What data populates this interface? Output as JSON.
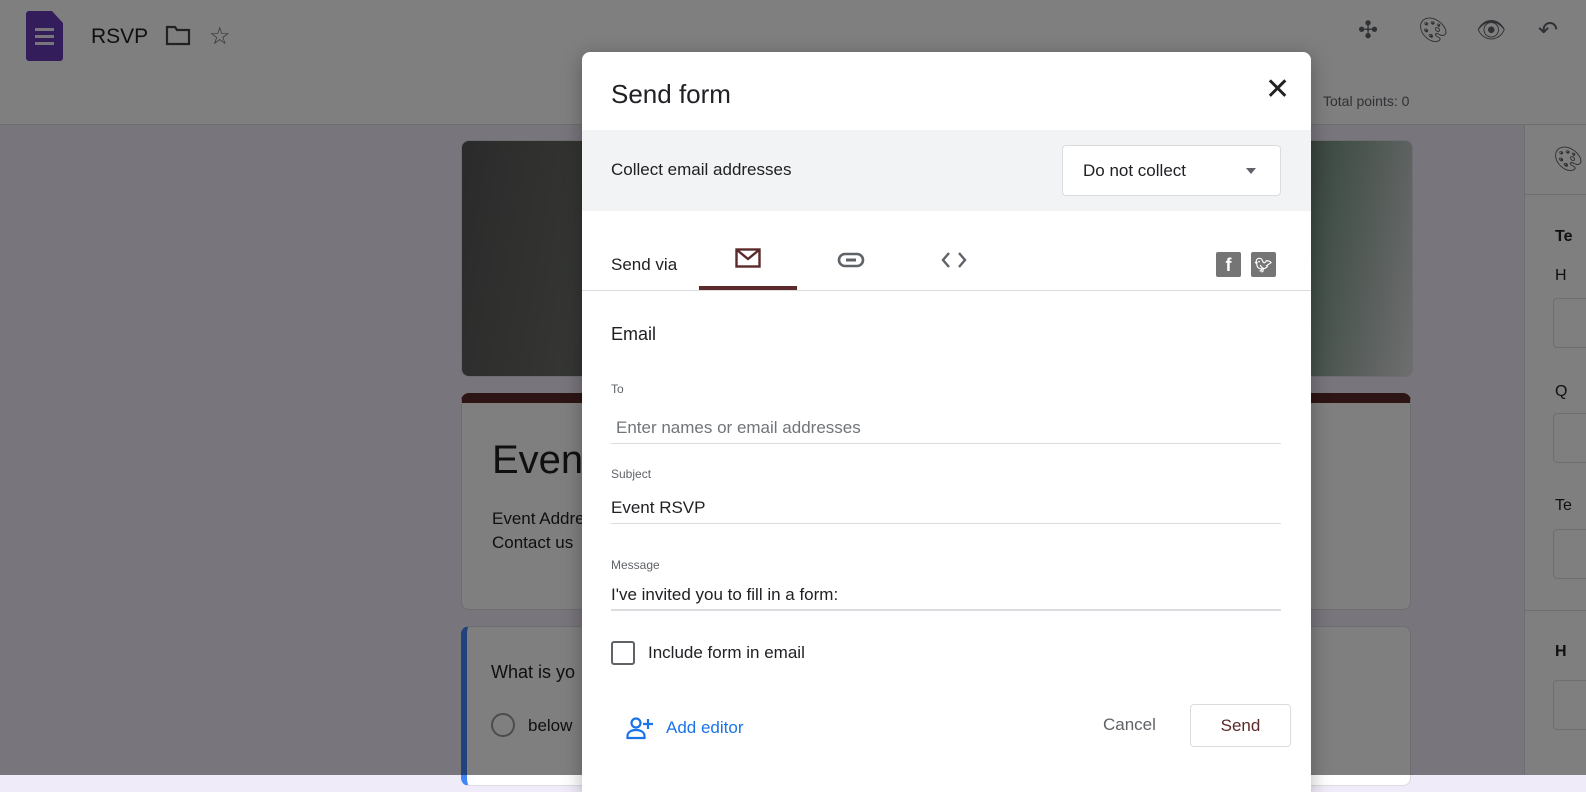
{
  "header": {
    "title": "RSVP",
    "total_points": "Total points: 0"
  },
  "background": {
    "form_title": "Event",
    "desc_line1": "Event Addre",
    "desc_line2": "Contact us",
    "question": "What is yo",
    "option": "below",
    "side_labels": [
      "Te",
      "H",
      "Q",
      "Te",
      "H"
    ]
  },
  "dialog": {
    "title": "Send form",
    "collect_label": "Collect email addresses",
    "collect_value": "Do not collect",
    "send_via": "Send via",
    "section": "Email",
    "to_label": "To",
    "to_placeholder": "Enter names or email addresses",
    "subject_label": "Subject",
    "subject_value": "Event RSVP",
    "message_label": "Message",
    "message_value": "I've invited you to fill in a form:",
    "include_label": "Include form in email",
    "include_checked": false,
    "add_editor": "Add editor",
    "cancel": "Cancel",
    "send": "Send"
  },
  "colors": {
    "accent": "#5b2a2a",
    "link": "#1a73e8",
    "forms_purple": "#673ab7"
  }
}
